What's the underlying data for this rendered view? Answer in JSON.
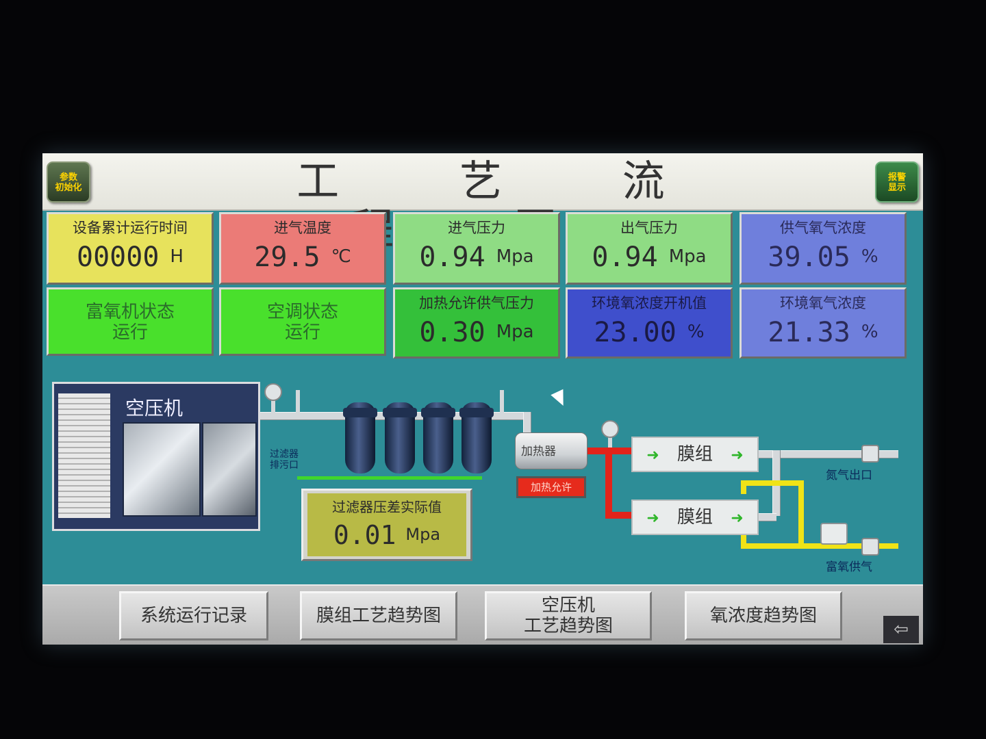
{
  "header": {
    "title": "工 艺 流 程 图",
    "left_button": "参数\n初始化",
    "right_button": "报警\n显示"
  },
  "tiles": {
    "runtime": {
      "label": "设备累计运行时间",
      "value": "00000",
      "unit": "H"
    },
    "intake_temp": {
      "label": "进气温度",
      "value": "29.5",
      "unit": "℃"
    },
    "intake_pressure": {
      "label": "进气压力",
      "value": "0.94",
      "unit": "Mpa"
    },
    "outlet_pressure": {
      "label": "出气压力",
      "value": "0.94",
      "unit": "Mpa"
    },
    "supply_o2": {
      "label": "供气氧气浓度",
      "value": "39.05",
      "unit": "%"
    },
    "machine_status": {
      "label": "富氧机状态",
      "value": "运行"
    },
    "ac_status": {
      "label": "空调状态",
      "value": "运行"
    },
    "heat_allow_pressure": {
      "label": "加热允许供气压力",
      "value": "0.30",
      "unit": "Mpa"
    },
    "env_o2_start": {
      "label": "环境氧浓度开机值",
      "value": "23.00",
      "unit": "%"
    },
    "env_o2": {
      "label": "环境氧气浓度",
      "value": "21.33",
      "unit": "%"
    }
  },
  "process": {
    "compressor_label": "空压机",
    "filter_drain_label": "过滤器\n排污口",
    "heater_label": "加热器",
    "heater_button": "加热允许",
    "membrane1": "膜组",
    "membrane2": "膜组",
    "arrow": "➜",
    "nitrogen_out": "氮气出口",
    "oxygen_out": "富氧供气",
    "filter_dp": {
      "label": "过滤器压差实际值",
      "value": "0.01",
      "unit": "Mpa"
    }
  },
  "nav": {
    "btn1": "系统运行记录",
    "btn2": "膜组工艺趋势图",
    "btn3": "空压机\n工艺趋势图",
    "btn4": "氧浓度趋势图",
    "back": "⇦"
  },
  "colors": {
    "background": "#2d8d97",
    "yellow_tile": "#e7e25c",
    "red_tile": "#eb7b77",
    "green_tile": "#8fdc84",
    "blue_tile": "#6f7fdc",
    "status_green": "#49e02c",
    "heater_red": "#e62b1c"
  }
}
